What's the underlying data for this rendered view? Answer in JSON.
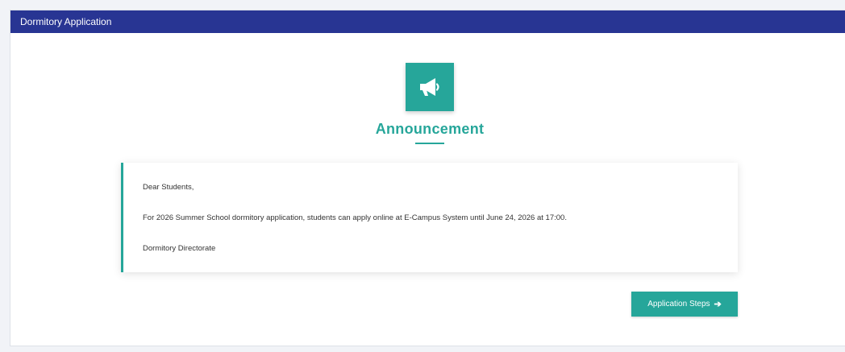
{
  "header": {
    "title": "Dormitory Application"
  },
  "announcement": {
    "icon": "megaphone-icon",
    "title": "Announcement",
    "greeting": "Dear Students,",
    "body": "For 2026 Summer School dormitory application, students can apply online at E-Campus System until June 24, 2026 at 17:00.",
    "signature": "Dormitory Directorate"
  },
  "actions": {
    "steps_label": "Application Steps",
    "steps_icon": "arrow-right-icon"
  },
  "colors": {
    "header_bg": "#283593",
    "accent": "#26a69a",
    "page_bg": "#f1f3f7"
  }
}
